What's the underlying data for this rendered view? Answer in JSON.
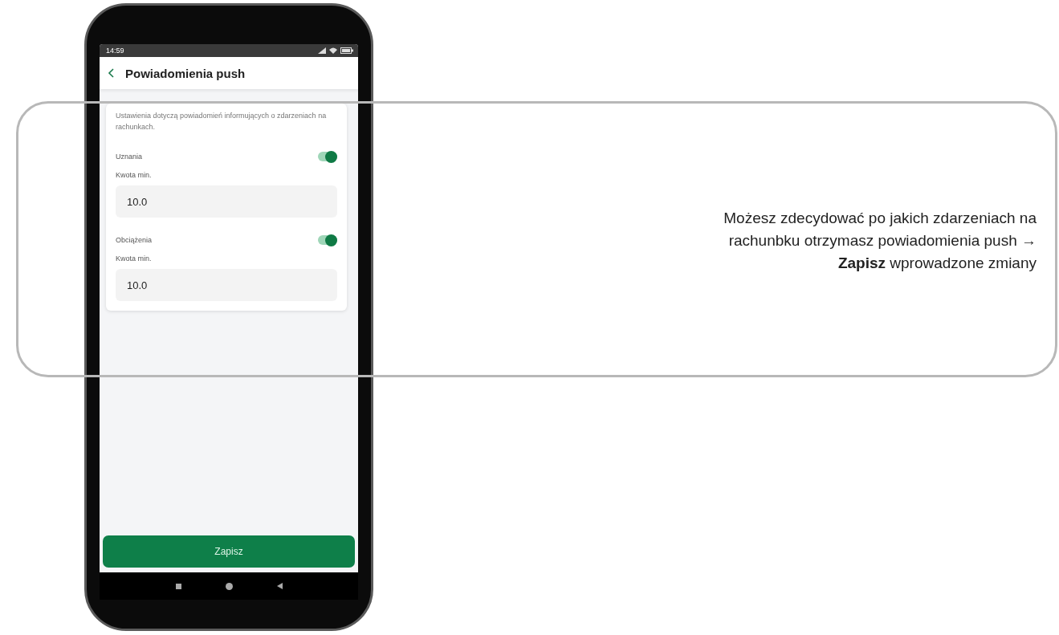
{
  "status_bar": {
    "time": "14:59"
  },
  "header": {
    "title": "Powiadomienia push"
  },
  "description": "Ustawienia dotyczą powiadomień informujących o zdarzeniach na rachunkach.",
  "settings": [
    {
      "label": "Uznania",
      "on": true,
      "amount_label": "Kwota min.",
      "amount": "10.0"
    },
    {
      "label": "Obciążenia",
      "on": true,
      "amount_label": "Kwota min.",
      "amount": "10.0"
    }
  ],
  "save_button": "Zapisz",
  "callout": "Możesz zdecydować po jakich zdarzeniach na rachunbku otrzymasz powiadomienia push → **Zapisz** wprowadzone zmiany"
}
